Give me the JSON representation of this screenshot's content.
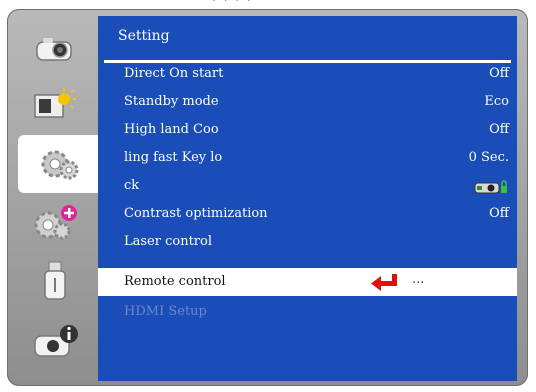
{
  "panel_title": "Setting",
  "menu_items": [
    {
      "label": "Direct On start",
      "value": "Off"
    },
    {
      "label": "Standby mode",
      "value": "Eco"
    },
    {
      "label": "High land  Coo",
      "value": "Off"
    },
    {
      "label": "ling fast  Key lo",
      "value": "0 Sec."
    },
    {
      "label": "ck",
      "value_icon": "projector-lock-icon"
    },
    {
      "label": "Contrast optimization",
      "value": "Off"
    },
    {
      "label": "Laser control",
      "value": ""
    },
    {
      "label": "Remote control",
      "value": "...",
      "selected": true
    },
    {
      "label": "HDMI Setup",
      "value": "",
      "disabled": true
    }
  ],
  "sidebar_icons": [
    "projector-icon",
    "picture-adjust-icon",
    "settings-gears-icon",
    "advanced-settings-gears-icon",
    "usb-icon",
    "information-icon"
  ],
  "colors": {
    "panel_blue": "#1a4db7",
    "frame_gray": "#a9a9a9",
    "highlight_white": "#ffffff",
    "arrow_red": "#e01010",
    "disabled_text": "#6f86c9"
  }
}
